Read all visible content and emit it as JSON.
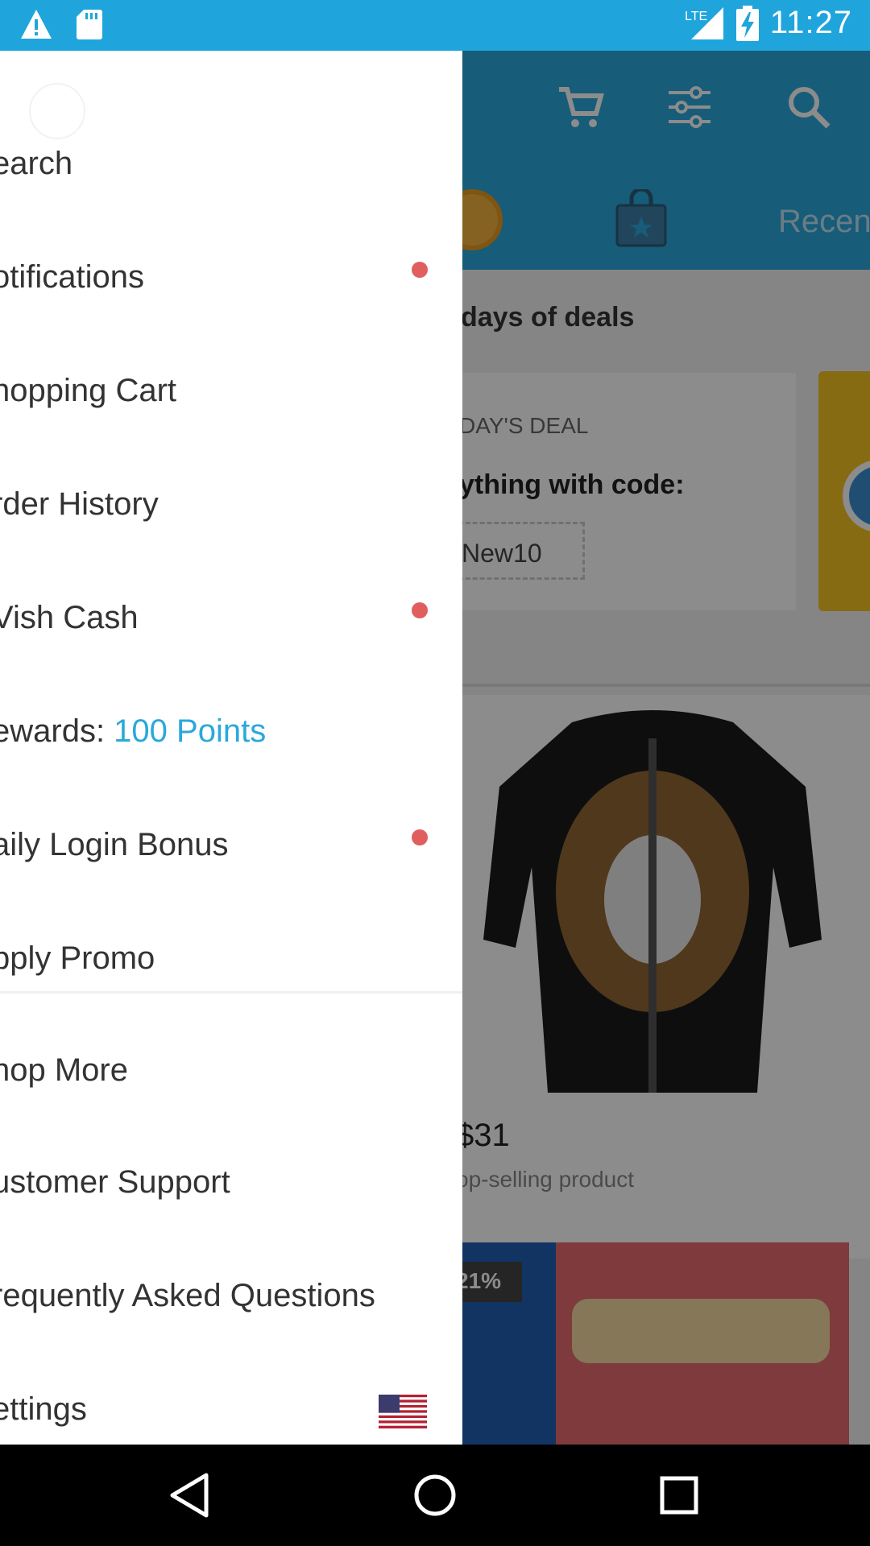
{
  "status_bar": {
    "time": "11:27",
    "network": "LTE",
    "icons": [
      "warning-icon",
      "sd-card-icon",
      "signal-icon",
      "battery-charging-icon"
    ]
  },
  "background": {
    "header_icons": [
      "cart-icon",
      "filter-icon",
      "search-icon"
    ],
    "recent_tab": "Recen",
    "deals_title": "days of deals",
    "deal_label": "DAY'S DEAL",
    "deal_text": "ything with code:",
    "deal_code": "New10",
    "product_price": "$31",
    "product_subtitle": "op-selling product",
    "discount_badge": "21%"
  },
  "drawer": {
    "items": [
      {
        "label": "earch",
        "badge": false
      },
      {
        "label": "otifications",
        "badge": true
      },
      {
        "label": "hopping Cart",
        "badge": false
      },
      {
        "label": "rder History",
        "badge": false
      },
      {
        "label": "Vish Cash",
        "badge": true
      },
      {
        "label": "ewards: ",
        "points": "100 Points",
        "badge": false
      },
      {
        "label": "aily Login Bonus",
        "badge": true
      },
      {
        "label": "pply Promo",
        "badge": false
      },
      {
        "label": "hop More",
        "badge": false
      },
      {
        "label": "ustomer Support",
        "badge": false
      },
      {
        "label": "requently Asked Questions",
        "badge": false
      },
      {
        "label": "ettings",
        "badge": false,
        "flag": "us-flag-icon"
      }
    ]
  },
  "nav_bar": {
    "buttons": [
      "back-icon",
      "home-icon",
      "recent-apps-icon"
    ]
  },
  "colors": {
    "brand_blue": "#1fa5dc",
    "points_blue": "#2aa8db",
    "badge_red": "#e05e5e"
  }
}
